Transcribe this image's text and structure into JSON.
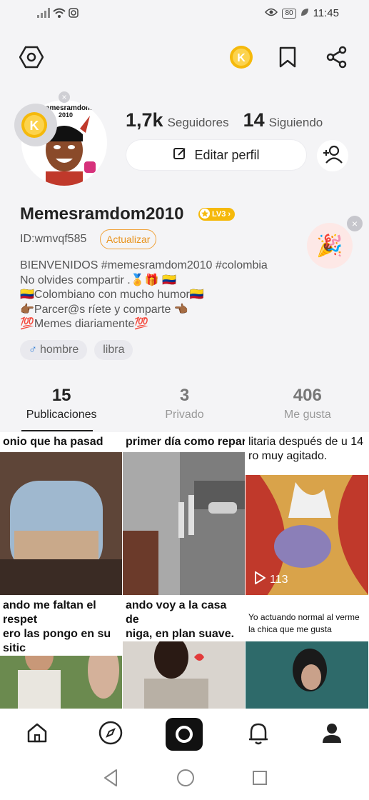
{
  "status_bar": {
    "time": "11:45",
    "battery": "80"
  },
  "profile": {
    "followers_count": "1,7k",
    "followers_label": "Seguidores",
    "following_count": "14",
    "following_label": "Siguiendo",
    "edit_label": "Editar perfil",
    "username": "Memesramdom2010",
    "level": "LV3",
    "user_id": "ID:wmvqf585",
    "update_label": "Actualizar",
    "avatar_text": "memesramdom 2010",
    "bio": "BIENVENIDOS #memesramdom2010 #colombia\nNo olvides compartir .🏅🎁 🇨🇴\n🇨🇴Colombiano con mucho humor🇨🇴\n👉🏾Parcer@s ríete y comparte 👈🏾\n💯Memes diariamente💯",
    "tags": [
      {
        "label": "hombre"
      },
      {
        "label": "libra"
      }
    ]
  },
  "tabs": [
    {
      "count": "15",
      "label": "Publicaciones"
    },
    {
      "count": "3",
      "label": "Privado"
    },
    {
      "count": "406",
      "label": "Me gusta"
    }
  ],
  "posts": [
    {
      "caption": "onio que ha pasad",
      "color": "#7a5a4a"
    },
    {
      "caption": "primer día como repart",
      "color": "#8a8a8a"
    },
    {
      "caption": "litaria después de u 14\nro muy agitado.",
      "color": "#c8553d",
      "plays": "113"
    },
    {
      "caption": "ando me faltan el respet\nero las  pongo en su sitic",
      "color": "#6b7a4f"
    },
    {
      "caption": "ando voy a la casa de \nniga, en plan suave.",
      "color": "#d4cfc9"
    },
    {
      "caption": "Yo actuando normal al verme\nla chica que me gusta",
      "color": "#2e6a6a"
    }
  ],
  "colors": {
    "accent": "#f5b90b",
    "update": "#e8921c",
    "dark": "#111111"
  }
}
